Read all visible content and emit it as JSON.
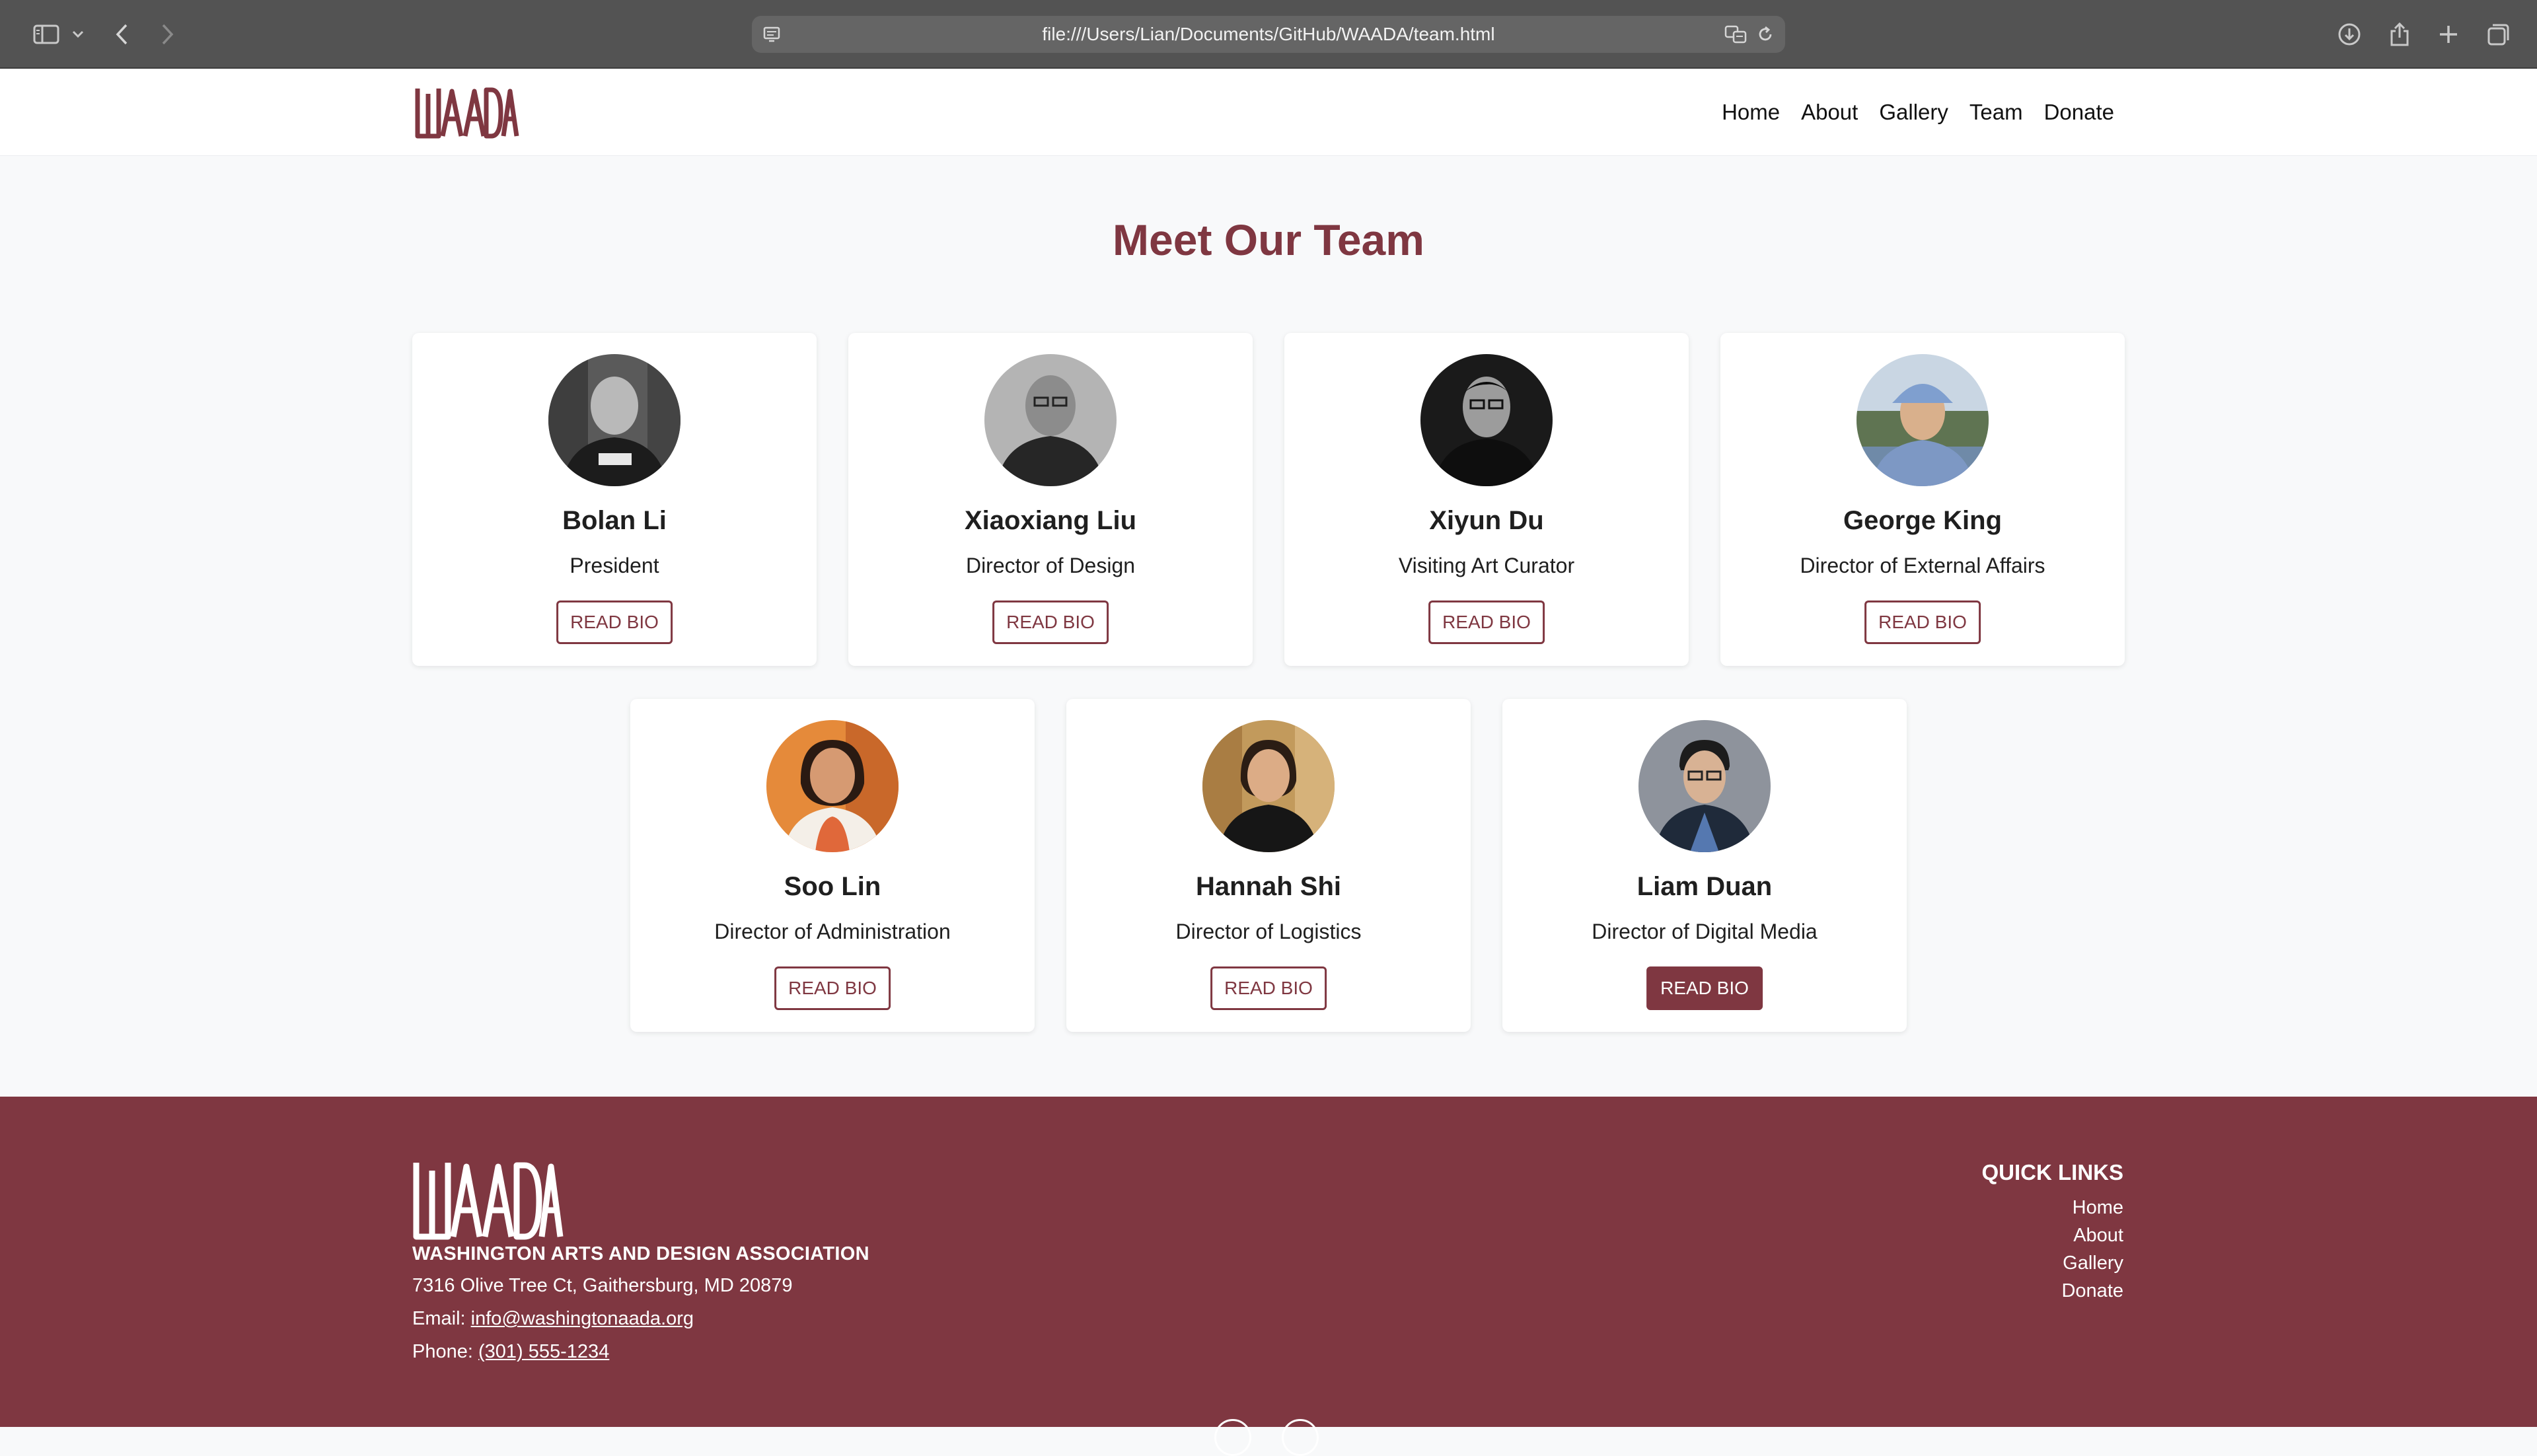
{
  "browser": {
    "url": "file:///Users/Lian/Documents/GitHub/WAADA/team.html"
  },
  "header": {
    "logo_text": "WAADA",
    "nav": [
      "Home",
      "About",
      "Gallery",
      "Team",
      "Donate"
    ]
  },
  "main": {
    "title": "Meet Our Team",
    "members": [
      {
        "name": "Bolan Li",
        "role": "President",
        "button": "READ BIO"
      },
      {
        "name": "Xiaoxiang Liu",
        "role": "Director of Design",
        "button": "READ BIO"
      },
      {
        "name": "Xiyun Du",
        "role": "Visiting Art Curator",
        "button": "READ BIO"
      },
      {
        "name": "George King",
        "role": "Director of External Affairs",
        "button": "READ BIO"
      },
      {
        "name": "Soo Lin",
        "role": "Director of Administration",
        "button": "READ BIO"
      },
      {
        "name": "Hannah Shi",
        "role": "Director of Logistics",
        "button": "READ BIO"
      },
      {
        "name": "Liam Duan",
        "role": "Director of Digital Media",
        "button": "READ BIO"
      }
    ]
  },
  "footer": {
    "org_name": "WASHINGTON ARTS AND DESIGN ASSOCIATION",
    "address": "7316 Olive Tree Ct, Gaithersburg, MD 20879",
    "email_label": "Email: ",
    "email": "info@washingtonaada.org",
    "phone_label": "Phone: ",
    "phone": "(301) 555-1234",
    "quick_links_title": "QUICK LINKS",
    "quick_links": [
      "Home",
      "About",
      "Gallery",
      "Donate"
    ]
  },
  "colors": {
    "brand": "#7f3741",
    "page_background": "#f8f9fa",
    "browser_chrome": "#535353"
  }
}
